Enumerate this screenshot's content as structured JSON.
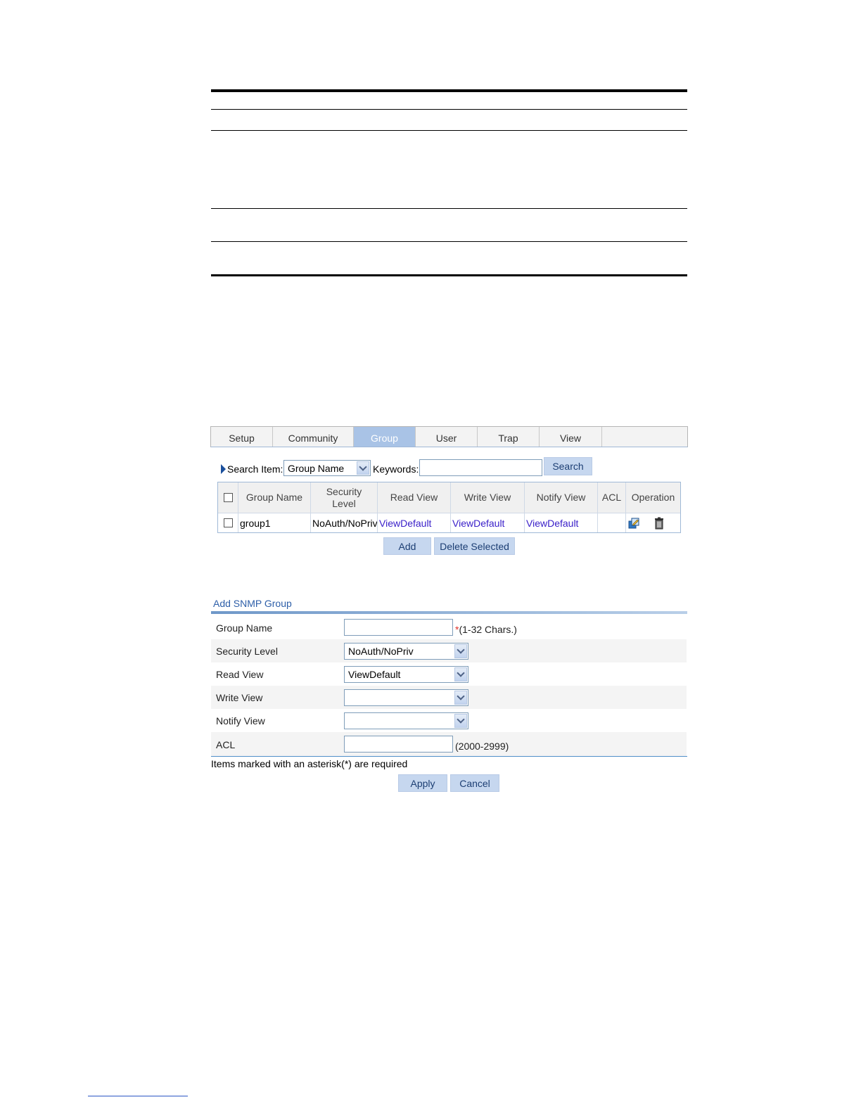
{
  "tabs": [
    "Setup",
    "Community",
    "Group",
    "User",
    "Trap",
    "View"
  ],
  "active_tab": "Group",
  "search": {
    "label": "Search Item:",
    "item_value": "Group Name",
    "keywords_label": "Keywords:",
    "keywords_value": "",
    "button": "Search"
  },
  "group_table": {
    "headers": {
      "group_name": "Group Name",
      "security": "Security",
      "level": "Level",
      "read_view": "Read View",
      "write_view": "Write View",
      "notify_view": "Notify View",
      "acl": "ACL",
      "operation": "Operation"
    },
    "rows": [
      {
        "group_name": "group1",
        "security_level": "NoAuth/NoPriv",
        "read_view": "ViewDefault",
        "write_view": "ViewDefault",
        "notify_view": "ViewDefault",
        "acl": ""
      }
    ]
  },
  "table_buttons": {
    "add": "Add",
    "delete_selected": "Delete Selected"
  },
  "form": {
    "title": "Add SNMP Group",
    "group_name_label": "Group Name",
    "group_name_value": "",
    "required_mark": "*",
    "group_name_hint": "(1-32 Chars.)",
    "security_level_label": "Security Level",
    "security_level_value": "NoAuth/NoPriv",
    "read_view_label": "Read View",
    "read_view_value": "ViewDefault",
    "write_view_label": "Write View",
    "write_view_value": "",
    "notify_view_label": "Notify View",
    "notify_view_value": "",
    "acl_label": "ACL",
    "acl_value": "",
    "acl_hint": "(2000-2999)",
    "note": "Items marked with an asterisk(*) are required",
    "apply": "Apply",
    "cancel": "Cancel"
  },
  "colors": {
    "active_tab": "#a9c3e6",
    "button": "#c6d7ef",
    "link": "#3a20c9",
    "form_title": "#2d5ea8"
  }
}
